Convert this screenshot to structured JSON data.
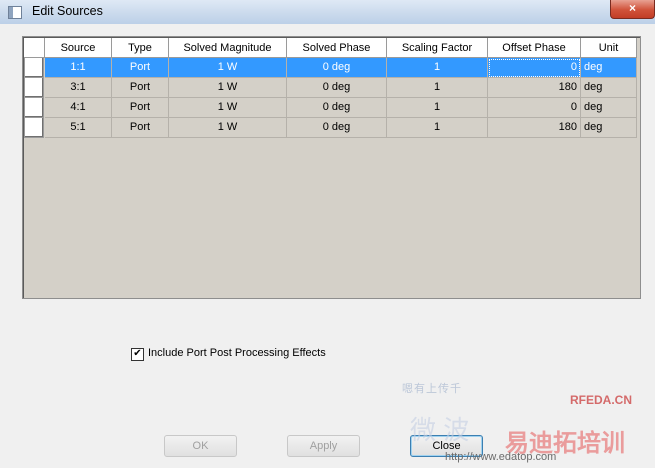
{
  "window": {
    "title": "Edit Sources",
    "close_glyph": "×"
  },
  "grid": {
    "columns": [
      "Source",
      "Type",
      "Solved Magnitude",
      "Solved Phase",
      "Scaling Factor",
      "Offset Phase",
      "Unit"
    ],
    "rows": [
      [
        "1:1",
        "Port",
        "1 W",
        "0 deg",
        "1",
        "0",
        "deg"
      ],
      [
        "3:1",
        "Port",
        "1 W",
        "0 deg",
        "1",
        "180",
        "deg"
      ],
      [
        "4:1",
        "Port",
        "1 W",
        "0 deg",
        "1",
        "0",
        "deg"
      ],
      [
        "5:1",
        "Port",
        "1 W",
        "0 deg",
        "1",
        "180",
        "deg"
      ]
    ],
    "selected_row": 0
  },
  "options": {
    "include_port_post": "Include Port Post Processing Effects",
    "include_port_post_checked": true,
    "check_glyph": "✔"
  },
  "buttons": {
    "ok": "OK",
    "apply": "Apply",
    "close": "Close"
  },
  "watermark": {
    "line1": "嗯有上传千",
    "brand": "RFEDA.CN",
    "cn": "易迪拓培训",
    "faint": "微 波",
    "url": "http://www.edatop.com"
  }
}
